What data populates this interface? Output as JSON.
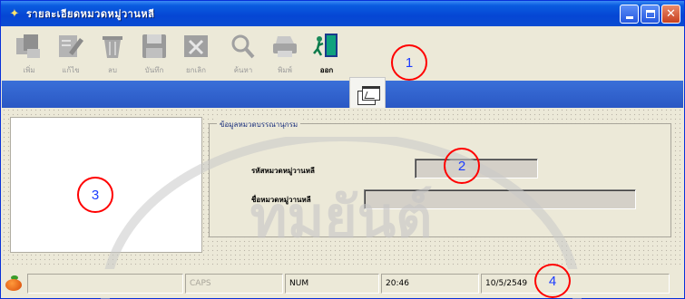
{
  "window": {
    "title": "รายละเอียดหมวดหมู่วานหลี"
  },
  "toolbar": {
    "items": [
      {
        "label": "เพิ่ม",
        "icon": "add-record-icon",
        "enabled": false
      },
      {
        "label": "แก้ไข",
        "icon": "edit-record-icon",
        "enabled": false
      },
      {
        "label": "ลบ",
        "icon": "delete-trash-icon",
        "enabled": false
      },
      {
        "label": "บันทึก",
        "icon": "save-disk-icon",
        "enabled": false
      },
      {
        "label": "ยกเลิก",
        "icon": "cancel-icon",
        "enabled": false
      },
      {
        "label": "ค้นหา",
        "icon": "search-magnifier-icon",
        "enabled": false
      },
      {
        "label": "พิมพ์",
        "icon": "printer-icon",
        "enabled": false
      },
      {
        "label": "ออก",
        "icon": "exit-door-icon",
        "enabled": true
      }
    ]
  },
  "callouts": [
    "1",
    "2",
    "3",
    "4"
  ],
  "form": {
    "group_title": "ข้อมูลหมวดบรรณานุกรม",
    "code_label": "รหัสหมวดหมู่วานหลี",
    "name_label": "ชื่อหมวดหมู่วานหลี",
    "code_value": "",
    "name_value": ""
  },
  "statusbar": {
    "caps": "CAPS",
    "num": "NUM",
    "time": "20:46",
    "date": "10/5/2549"
  },
  "watermark": {
    "text": "ทมยันต์"
  },
  "colors": {
    "titlebar": "#0a4cd2",
    "blueband": "#2a58c4",
    "callout_border": "#ff0000",
    "callout_text": "#1b3cff"
  }
}
